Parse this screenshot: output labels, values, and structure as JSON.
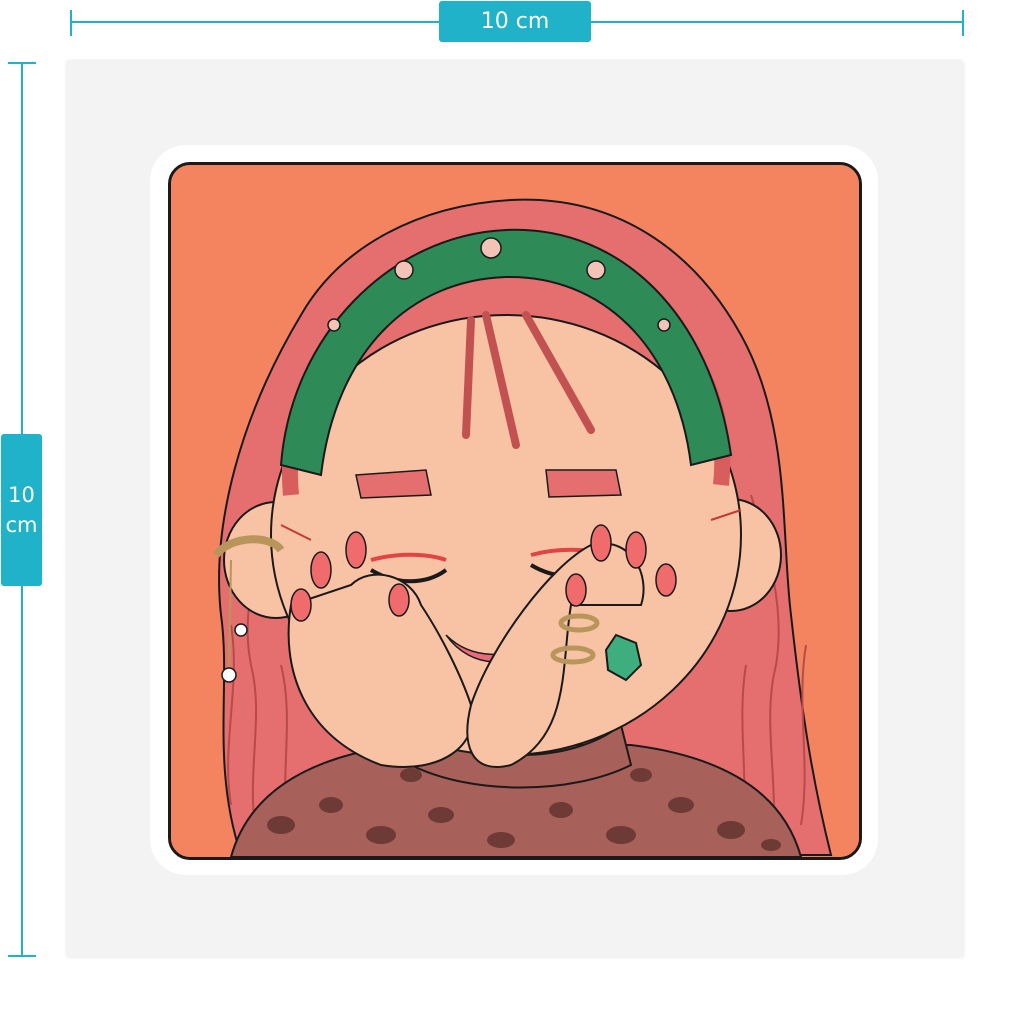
{
  "dimensions": {
    "width_label": "10 cm",
    "height_label_number": "10",
    "height_label_unit": "cm"
  },
  "sticker": {
    "colors": {
      "background": "#f4845f",
      "hair": "#e56f6f",
      "skin": "#f8c2a4",
      "headband": "#2e8a57",
      "ring_gem": "#3fae7f",
      "sweater": "#a7605a",
      "outline": "#1a1a1a",
      "guide": "#20b2c8"
    }
  }
}
